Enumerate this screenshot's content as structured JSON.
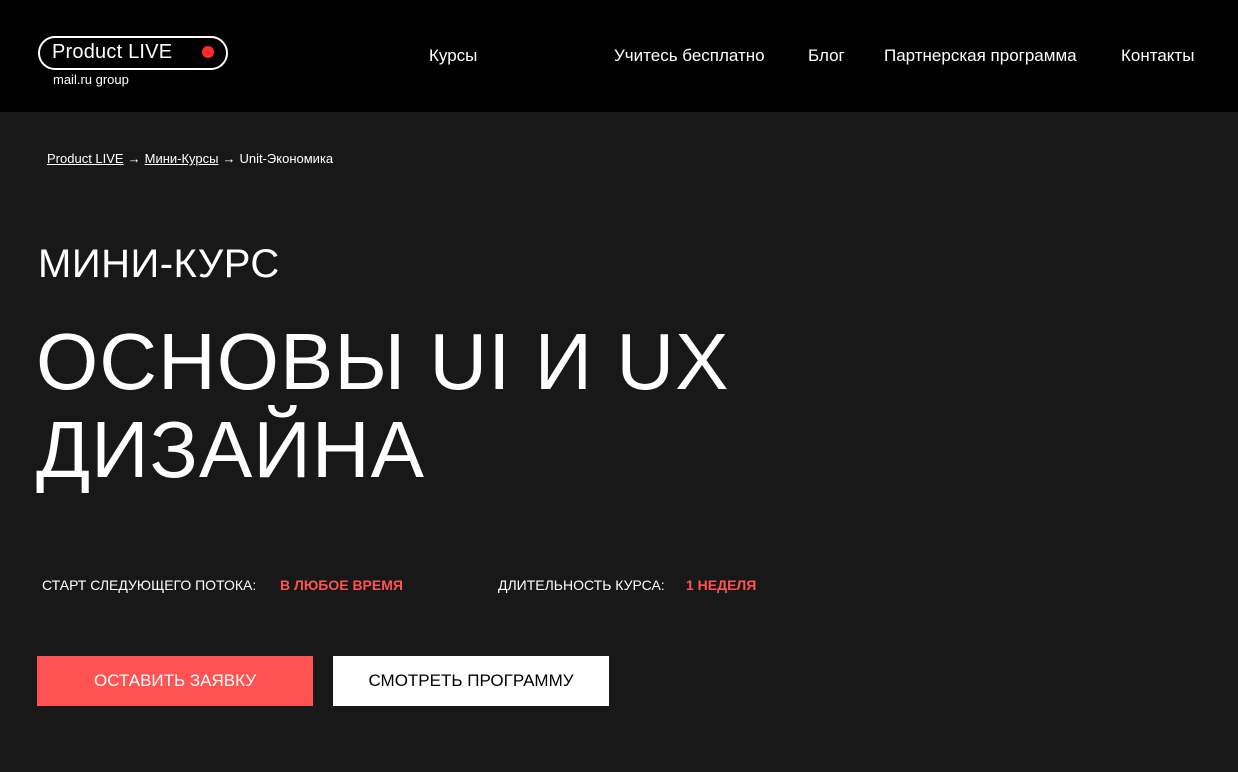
{
  "logo": {
    "name": "Product LIVE",
    "subtitle": "mail.ru group",
    "dot_color": "#ff2a2a"
  },
  "nav": {
    "items": [
      {
        "label": "Курсы"
      },
      {
        "label": "Учитесь бесплатно"
      },
      {
        "label": "Блог"
      },
      {
        "label": "Партнерская программа"
      },
      {
        "label": "Контакты"
      }
    ]
  },
  "breadcrumb": {
    "items": [
      "Product LIVE",
      "Мини-Курсы",
      "Unit-Экономика"
    ],
    "separator": "→"
  },
  "hero": {
    "eyebrow": "МИНИ-КУРС",
    "title": "ОСНОВЫ UI И UX ДИЗАЙНА"
  },
  "meta": {
    "start_label": "СТАРТ СЛЕДУЮЩЕГО ПОТОКА:",
    "start_value": "В ЛЮБОЕ ВРЕМЯ",
    "duration_label": "ДЛИТЕЛЬНОСТЬ КУРСА:",
    "duration_value": "1 НЕДЕЛЯ"
  },
  "buttons": {
    "apply_label": "ОСТАВИТЬ ЗАЯВКУ",
    "program_label": "СМОТРЕТЬ ПРОГРАММУ"
  },
  "colors": {
    "header_bg": "#000000",
    "page_bg": "#181818",
    "accent": "#ff5252",
    "text": "#ffffff"
  }
}
